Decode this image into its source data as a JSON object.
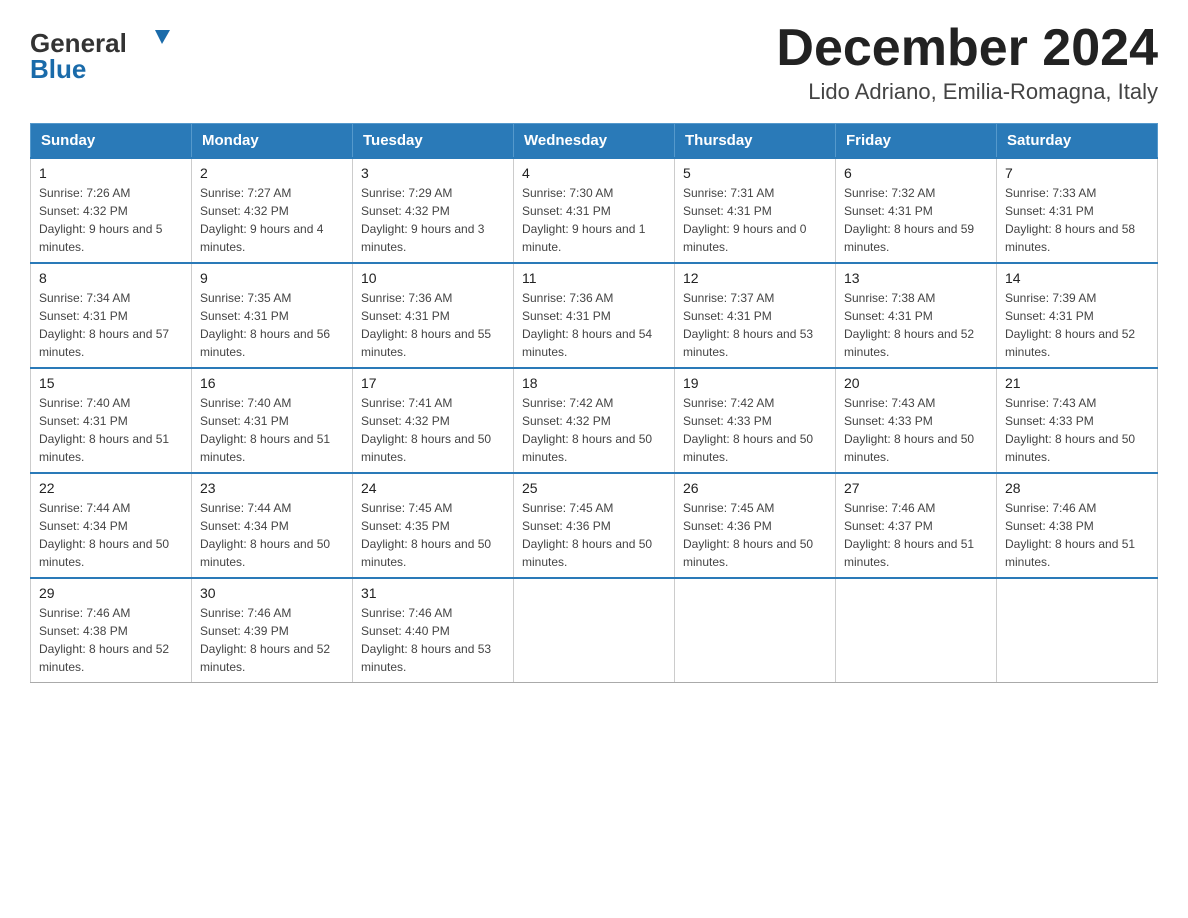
{
  "header": {
    "title": "December 2024",
    "subtitle": "Lido Adriano, Emilia-Romagna, Italy"
  },
  "logo": {
    "line1": "General",
    "line2": "Blue"
  },
  "days_of_week": [
    "Sunday",
    "Monday",
    "Tuesday",
    "Wednesday",
    "Thursday",
    "Friday",
    "Saturday"
  ],
  "weeks": [
    [
      {
        "num": "1",
        "sunrise": "7:26 AM",
        "sunset": "4:32 PM",
        "daylight": "9 hours and 5 minutes."
      },
      {
        "num": "2",
        "sunrise": "7:27 AM",
        "sunset": "4:32 PM",
        "daylight": "9 hours and 4 minutes."
      },
      {
        "num": "3",
        "sunrise": "7:29 AM",
        "sunset": "4:32 PM",
        "daylight": "9 hours and 3 minutes."
      },
      {
        "num": "4",
        "sunrise": "7:30 AM",
        "sunset": "4:31 PM",
        "daylight": "9 hours and 1 minute."
      },
      {
        "num": "5",
        "sunrise": "7:31 AM",
        "sunset": "4:31 PM",
        "daylight": "9 hours and 0 minutes."
      },
      {
        "num": "6",
        "sunrise": "7:32 AM",
        "sunset": "4:31 PM",
        "daylight": "8 hours and 59 minutes."
      },
      {
        "num": "7",
        "sunrise": "7:33 AM",
        "sunset": "4:31 PM",
        "daylight": "8 hours and 58 minutes."
      }
    ],
    [
      {
        "num": "8",
        "sunrise": "7:34 AM",
        "sunset": "4:31 PM",
        "daylight": "8 hours and 57 minutes."
      },
      {
        "num": "9",
        "sunrise": "7:35 AM",
        "sunset": "4:31 PM",
        "daylight": "8 hours and 56 minutes."
      },
      {
        "num": "10",
        "sunrise": "7:36 AM",
        "sunset": "4:31 PM",
        "daylight": "8 hours and 55 minutes."
      },
      {
        "num": "11",
        "sunrise": "7:36 AM",
        "sunset": "4:31 PM",
        "daylight": "8 hours and 54 minutes."
      },
      {
        "num": "12",
        "sunrise": "7:37 AM",
        "sunset": "4:31 PM",
        "daylight": "8 hours and 53 minutes."
      },
      {
        "num": "13",
        "sunrise": "7:38 AM",
        "sunset": "4:31 PM",
        "daylight": "8 hours and 52 minutes."
      },
      {
        "num": "14",
        "sunrise": "7:39 AM",
        "sunset": "4:31 PM",
        "daylight": "8 hours and 52 minutes."
      }
    ],
    [
      {
        "num": "15",
        "sunrise": "7:40 AM",
        "sunset": "4:31 PM",
        "daylight": "8 hours and 51 minutes."
      },
      {
        "num": "16",
        "sunrise": "7:40 AM",
        "sunset": "4:31 PM",
        "daylight": "8 hours and 51 minutes."
      },
      {
        "num": "17",
        "sunrise": "7:41 AM",
        "sunset": "4:32 PM",
        "daylight": "8 hours and 50 minutes."
      },
      {
        "num": "18",
        "sunrise": "7:42 AM",
        "sunset": "4:32 PM",
        "daylight": "8 hours and 50 minutes."
      },
      {
        "num": "19",
        "sunrise": "7:42 AM",
        "sunset": "4:33 PM",
        "daylight": "8 hours and 50 minutes."
      },
      {
        "num": "20",
        "sunrise": "7:43 AM",
        "sunset": "4:33 PM",
        "daylight": "8 hours and 50 minutes."
      },
      {
        "num": "21",
        "sunrise": "7:43 AM",
        "sunset": "4:33 PM",
        "daylight": "8 hours and 50 minutes."
      }
    ],
    [
      {
        "num": "22",
        "sunrise": "7:44 AM",
        "sunset": "4:34 PM",
        "daylight": "8 hours and 50 minutes."
      },
      {
        "num": "23",
        "sunrise": "7:44 AM",
        "sunset": "4:34 PM",
        "daylight": "8 hours and 50 minutes."
      },
      {
        "num": "24",
        "sunrise": "7:45 AM",
        "sunset": "4:35 PM",
        "daylight": "8 hours and 50 minutes."
      },
      {
        "num": "25",
        "sunrise": "7:45 AM",
        "sunset": "4:36 PM",
        "daylight": "8 hours and 50 minutes."
      },
      {
        "num": "26",
        "sunrise": "7:45 AM",
        "sunset": "4:36 PM",
        "daylight": "8 hours and 50 minutes."
      },
      {
        "num": "27",
        "sunrise": "7:46 AM",
        "sunset": "4:37 PM",
        "daylight": "8 hours and 51 minutes."
      },
      {
        "num": "28",
        "sunrise": "7:46 AM",
        "sunset": "4:38 PM",
        "daylight": "8 hours and 51 minutes."
      }
    ],
    [
      {
        "num": "29",
        "sunrise": "7:46 AM",
        "sunset": "4:38 PM",
        "daylight": "8 hours and 52 minutes."
      },
      {
        "num": "30",
        "sunrise": "7:46 AM",
        "sunset": "4:39 PM",
        "daylight": "8 hours and 52 minutes."
      },
      {
        "num": "31",
        "sunrise": "7:46 AM",
        "sunset": "4:40 PM",
        "daylight": "8 hours and 53 minutes."
      },
      null,
      null,
      null,
      null
    ]
  ]
}
